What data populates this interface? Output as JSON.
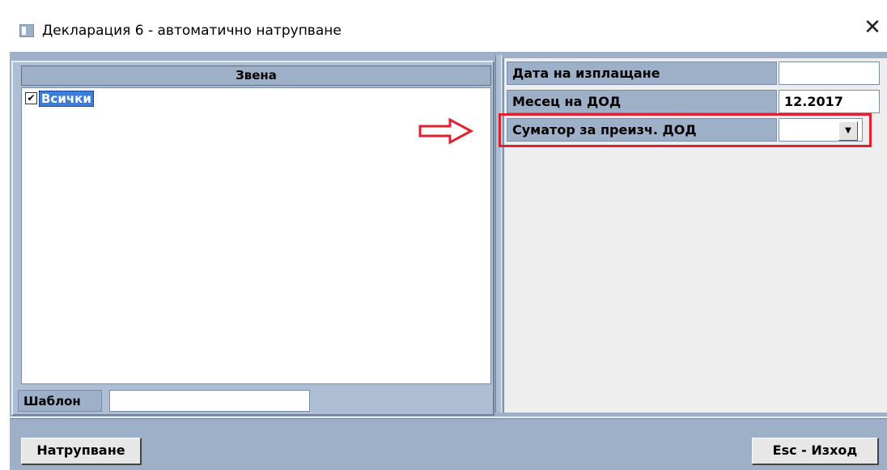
{
  "window": {
    "title": "Декларация 6 - автоматично натрупване",
    "close_symbol": "✕"
  },
  "units_list": {
    "header": "Звена",
    "items": [
      {
        "label": "Всички",
        "checked": true,
        "check_symbol": "✔"
      }
    ]
  },
  "template": {
    "label": "Шаблон",
    "value": ""
  },
  "properties": [
    {
      "label": "Дата на изплащане",
      "value": ""
    },
    {
      "label": "Месец на ДОД",
      "value": "12.2017"
    },
    {
      "label": "Суматор за преизч. ДОД",
      "value": "",
      "dropdown_symbol": "▼"
    }
  ],
  "annotation": {
    "highlight_color": "#e0212f",
    "arrow_icon": "arrow-right-outline-icon"
  },
  "buttons": {
    "accumulate": "Натрупване",
    "exit": "Esc - Изход"
  },
  "colors": {
    "panel_blue": "#9db0c8",
    "selection_blue": "#3b7fd9"
  }
}
